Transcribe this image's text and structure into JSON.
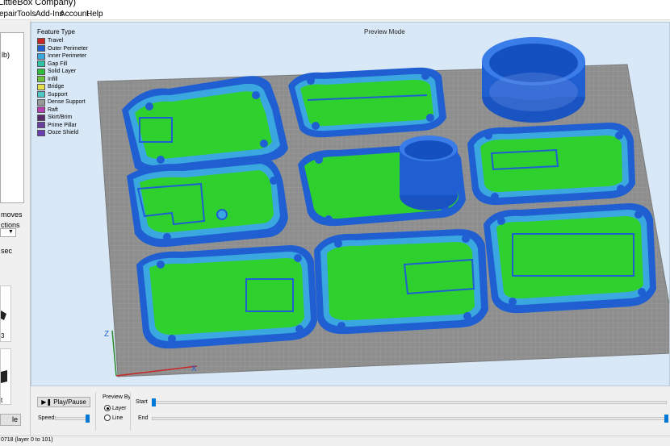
{
  "window": {
    "title": "LittleBox Company)"
  },
  "menu": {
    "items": [
      "epair",
      "Tools",
      "Add-Ins",
      "Account",
      "Help"
    ]
  },
  "left_panel": {
    "tree_text": "lb)",
    "moves_text": "moves",
    "options_text": "ctions",
    "sec_text": "sec",
    "thumb1_caption": "3",
    "thumb2_caption": "t",
    "button_label": "le"
  },
  "viewport": {
    "title": "Preview Mode",
    "legend": {
      "title": "Feature Type",
      "items": [
        {
          "label": "Travel",
          "color": "#c62727"
        },
        {
          "label": "Outer Perimeter",
          "color": "#1f5fd1"
        },
        {
          "label": "Inner Perimeter",
          "color": "#3aa7e0"
        },
        {
          "label": "Gap Fill",
          "color": "#2ec4a5"
        },
        {
          "label": "Solid Layer",
          "color": "#2fbf3c"
        },
        {
          "label": "Infill",
          "color": "#6ec23c"
        },
        {
          "label": "Bridge",
          "color": "#e6e04a"
        },
        {
          "label": "Support",
          "color": "#4ec7c7"
        },
        {
          "label": "Dense Support",
          "color": "#9a9a9a"
        },
        {
          "label": "Raft",
          "color": "#b440b4"
        },
        {
          "label": "Skirt/Brim",
          "color": "#5a2a6a"
        },
        {
          "label": "Prime Pillar",
          "color": "#6a3fa0"
        },
        {
          "label": "Ooze Shield",
          "color": "#6b3db0"
        }
      ]
    },
    "axis_labels": {
      "z": "Z",
      "x": "X"
    },
    "colors": {
      "bed": "#8e8e8e",
      "outer": "#1f5fd1",
      "inner": "#3aa7e0",
      "solid": "#2fd42f"
    }
  },
  "controls": {
    "play_label": "▶❚ Play/Pause",
    "speed_label": "Speed:",
    "preview_by_label": "Preview By",
    "layer_label": "Layer",
    "line_label": "Line",
    "start_label": "Start",
    "end_label": "End",
    "preview_by_selected": "Layer"
  },
  "status": {
    "text": "0718 (layer 0 to 101)"
  }
}
